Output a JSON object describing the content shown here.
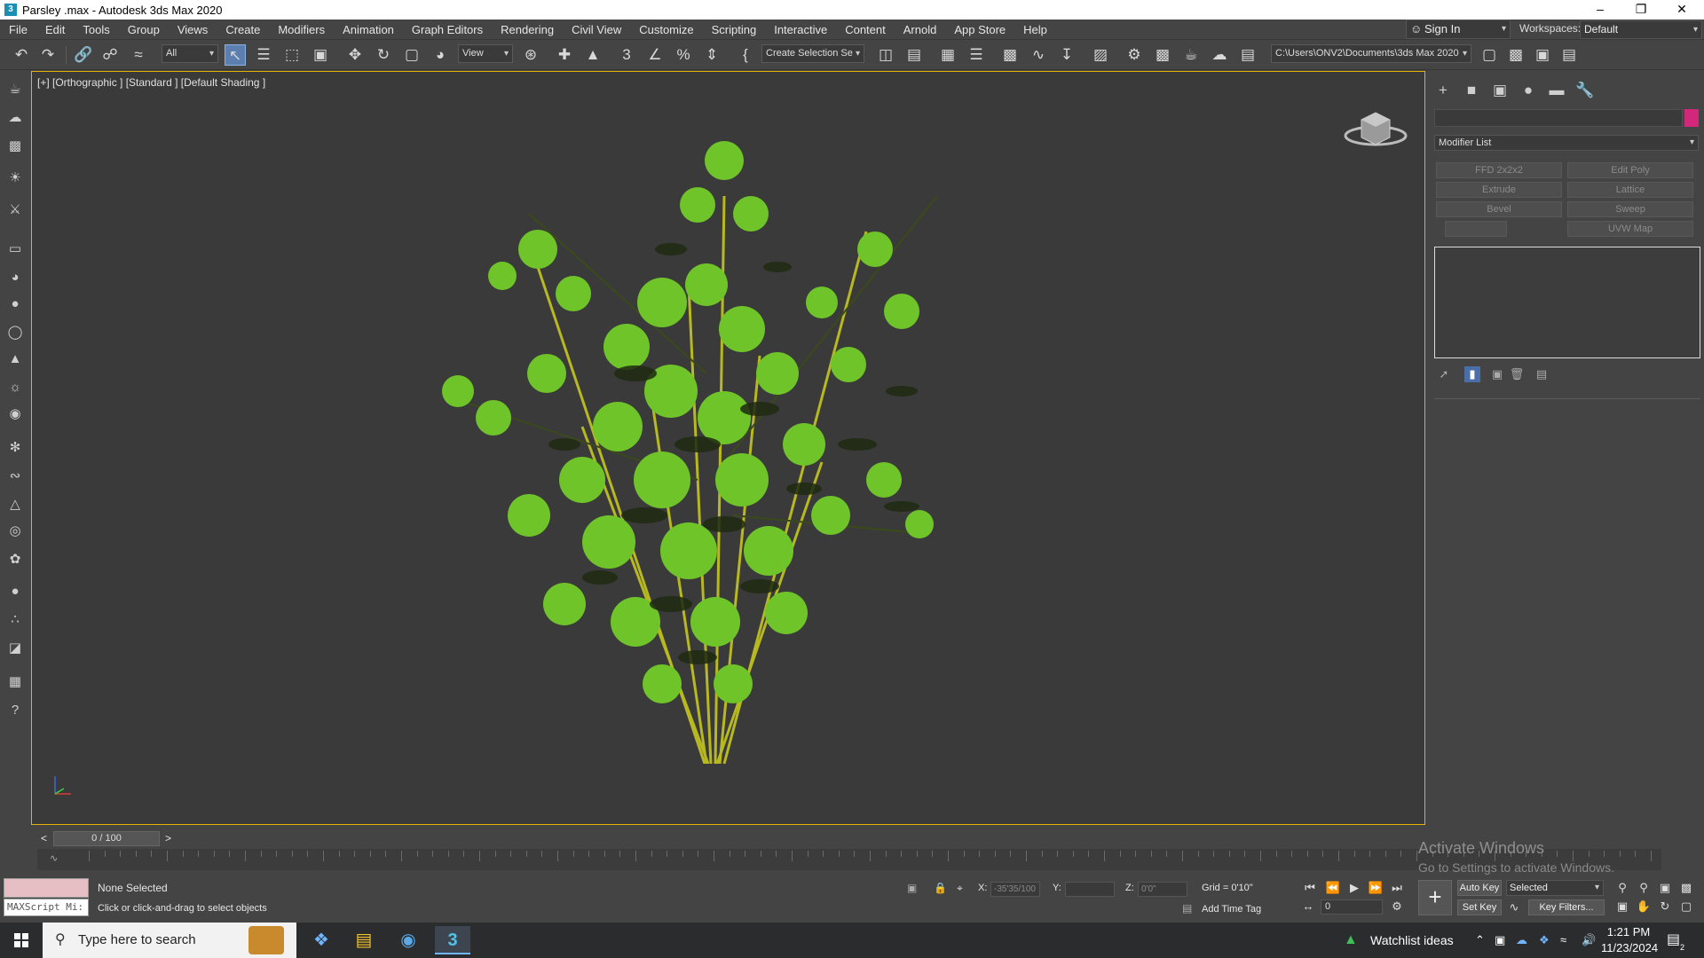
{
  "window": {
    "title": "Parsley .max - Autodesk 3ds Max 2020",
    "app_icon": "3"
  },
  "menu": [
    "File",
    "Edit",
    "Tools",
    "Group",
    "Views",
    "Create",
    "Modifiers",
    "Animation",
    "Graph Editors",
    "Rendering",
    "Civil View",
    "Customize",
    "Scripting",
    "Interactive",
    "Content",
    "Arnold",
    "App Store",
    "Help"
  ],
  "account": {
    "signin": "Sign In",
    "workspace_label": "Workspaces:",
    "workspace": "Default"
  },
  "toolbar": {
    "filter": "All",
    "refcoord": "View",
    "selection_set": "Create Selection Se",
    "project_path": "C:\\Users\\ONV2\\Documents\\3ds Max 2020"
  },
  "viewport": {
    "label": "[+] [Orthographic ] [Standard ] [Default Shading ]"
  },
  "command_panel": {
    "modifier_list": "Modifier List",
    "modifiers": [
      "FFD 2x2x2",
      "Edit Poly",
      "Extrude",
      "Lattice",
      "Bevel",
      "Sweep",
      "",
      "UVW Map"
    ],
    "object_color": "#d2277a"
  },
  "timeline": {
    "frame_display": "0 / 100",
    "prev": "<",
    "next": ">"
  },
  "status": {
    "selection": "None Selected",
    "prompt": "Click or click-and-drag to select objects",
    "x_label": "X:",
    "x_value": "-35'35/100",
    "y_label": "Y:",
    "y_value": "",
    "z_label": "Z:",
    "z_value": "0'0\"",
    "grid": "Grid = 0'10\"",
    "add_time_tag": "Add Time Tag",
    "maxscript": "MAXScript Mi:",
    "autokey": "Auto Key",
    "keymode": "Selected",
    "setkey": "Set Key",
    "key_filters": "Key Filters...",
    "frame": "0"
  },
  "watermark": {
    "line1": "Activate Windows",
    "line2": "Go to Settings to activate Windows."
  },
  "taskbar": {
    "search_placeholder": "Type here to search",
    "weather": "Watchlist ideas",
    "time": "1:21 PM",
    "date": "11/23/2024",
    "notifications": "2"
  }
}
